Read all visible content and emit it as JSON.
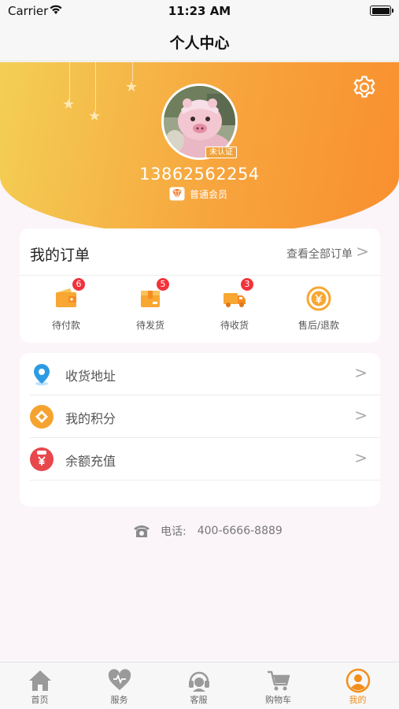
{
  "status_bar": {
    "carrier": "Carrier",
    "time": "11:23 AM"
  },
  "nav": {
    "title": "个人中心"
  },
  "profile": {
    "verify_badge": "未认证",
    "phone": "13862562254",
    "member_level": "普通会员"
  },
  "orders": {
    "title": "我的订单",
    "view_all": "查看全部订单",
    "chevron": ">",
    "items": [
      {
        "label": "待付款",
        "count": "6",
        "icon": "wallet-icon"
      },
      {
        "label": "待发货",
        "count": "5",
        "icon": "package-icon"
      },
      {
        "label": "待收货",
        "count": "3",
        "icon": "delivery-truck-icon"
      },
      {
        "label": "售后/退款",
        "count": "",
        "icon": "refund-yen-icon"
      }
    ]
  },
  "menu": {
    "items": [
      {
        "label": "收货地址",
        "icon": "location-pin-icon"
      },
      {
        "label": "我的积分",
        "icon": "points-diamond-icon"
      },
      {
        "label": "余额充值",
        "icon": "recharge-yen-icon"
      }
    ],
    "chevron": ">"
  },
  "contact": {
    "label": "电话:",
    "number": "400-6666-8889"
  },
  "tabbar": {
    "items": [
      {
        "label": "首页",
        "icon": "home-icon",
        "active": false
      },
      {
        "label": "服务",
        "icon": "heart-icon",
        "active": false
      },
      {
        "label": "客服",
        "icon": "headset-icon",
        "active": false
      },
      {
        "label": "购物车",
        "icon": "cart-icon",
        "active": false
      },
      {
        "label": "我的",
        "icon": "user-icon",
        "active": true
      }
    ]
  },
  "colors": {
    "accent": "#f28e1c",
    "header_gradient_start": "#f3cf54",
    "header_gradient_end": "#f98f2e",
    "badge_red": "#f2323a"
  }
}
